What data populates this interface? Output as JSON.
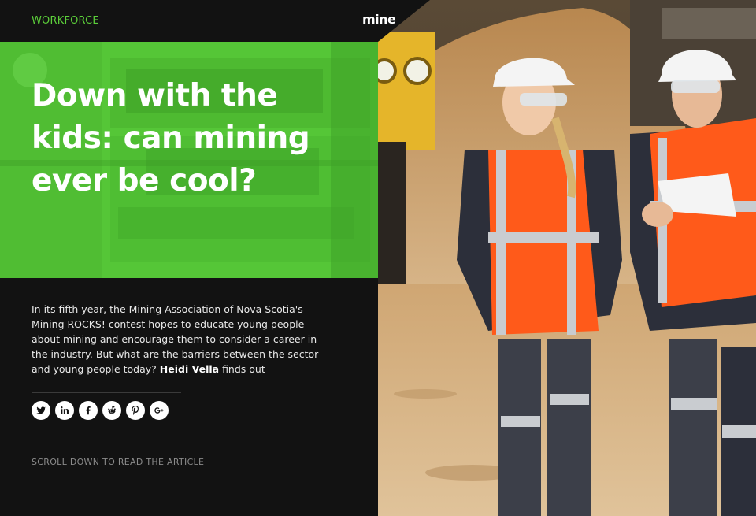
{
  "header": {
    "section": "WORKFORCE",
    "logo": "mine"
  },
  "hero": {
    "title": "Down with the kids: can mining ever be cool?"
  },
  "article": {
    "standfirst_text": "In its fifth year, the Mining Association of Nova Scotia's Mining ROCKS! contest hopes to educate young people about mining and encourage them to consider a career in the industry. But what are the barriers between the sector and young people today?",
    "author": "Heidi Vella",
    "author_suffix": "finds out"
  },
  "share": {
    "icons": [
      "twitter-icon",
      "linkedin-icon",
      "facebook-icon",
      "reddit-icon",
      "pinterest-icon",
      "google-plus-icon"
    ]
  },
  "footer": {
    "scroll_hint": "SCROLL DOWN TO READ THE ARTICLE"
  },
  "colors": {
    "accent_green": "#55c637",
    "section_green": "#5ccf3a",
    "background": "#121212",
    "vest_orange": "#ff5a1a"
  }
}
